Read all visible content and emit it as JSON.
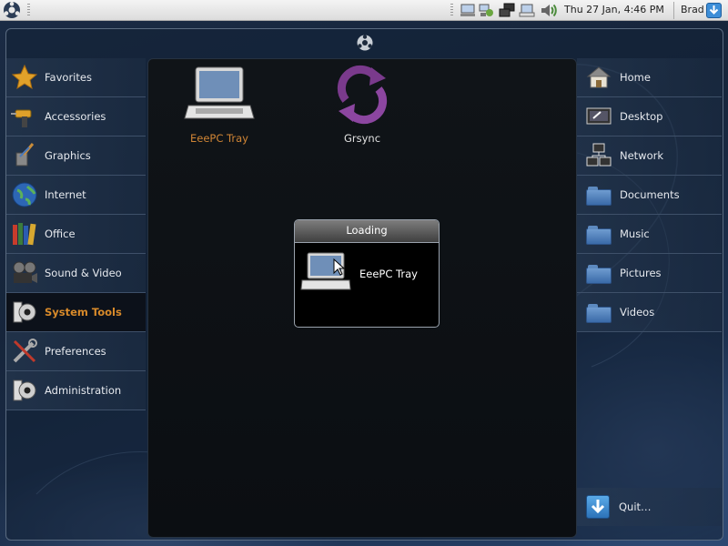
{
  "top_panel": {
    "clock": "Thu 27 Jan,  4:46 PM",
    "user": "Brad",
    "tray_icons": [
      "display-icon",
      "network-status-icon",
      "network-connections-icon",
      "eeepc-tray-icon",
      "volume-icon"
    ]
  },
  "categories": [
    {
      "label": "Favorites",
      "icon": "star-icon",
      "active": false
    },
    {
      "label": "Accessories",
      "icon": "drill-icon",
      "active": false
    },
    {
      "label": "Graphics",
      "icon": "paintbrush-icon",
      "active": false
    },
    {
      "label": "Internet",
      "icon": "globe-icon",
      "active": false
    },
    {
      "label": "Office",
      "icon": "books-icon",
      "active": false
    },
    {
      "label": "Sound & Video",
      "icon": "film-reel-icon",
      "active": false
    },
    {
      "label": "System Tools",
      "icon": "system-tools-icon",
      "active": true
    },
    {
      "label": "Preferences",
      "icon": "tools-icon",
      "active": false
    },
    {
      "label": "Administration",
      "icon": "admin-icon",
      "active": false
    }
  ],
  "apps": [
    {
      "label": "EeePC Tray",
      "icon": "laptop-icon",
      "selected": true
    },
    {
      "label": "Grsync",
      "icon": "sync-arrows-icon",
      "selected": false
    }
  ],
  "loading_dialog": {
    "title": "Loading",
    "app_label": "EeePC Tray"
  },
  "places": [
    {
      "label": "Home",
      "icon": "house-icon"
    },
    {
      "label": "Desktop",
      "icon": "desktop-icon"
    },
    {
      "label": "Network",
      "icon": "network-icon"
    },
    {
      "label": "Documents",
      "icon": "folder-icon"
    },
    {
      "label": "Music",
      "icon": "folder-icon"
    },
    {
      "label": "Pictures",
      "icon": "folder-icon"
    },
    {
      "label": "Videos",
      "icon": "folder-icon"
    }
  ],
  "quit_label": "Quit…",
  "colors": {
    "active_category": "#d88a2a",
    "selected_app_label": "#d08535",
    "panel_bg": "#e8e8e8",
    "quit_blue": "#3d8ed8"
  }
}
